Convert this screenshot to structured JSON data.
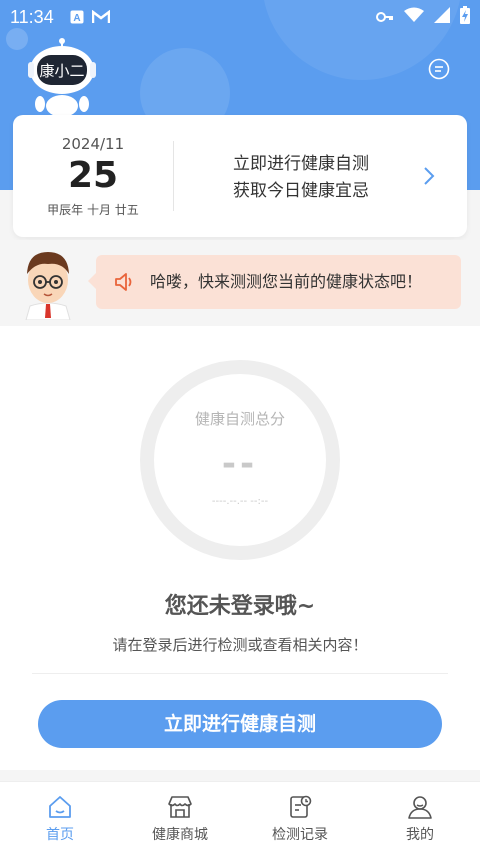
{
  "status_bar": {
    "time": "11:34",
    "icons": [
      "a-notification-icon",
      "gmail-icon",
      "key-icon",
      "wifi-icon",
      "signal-icon",
      "battery-charging-icon"
    ]
  },
  "header": {
    "mascot_text": "康小二",
    "message_icon": "message-bubble-icon"
  },
  "date_card": {
    "year_month": "2024/11",
    "day": "25",
    "lunar": "甲辰年 十月 廿五",
    "cta_line1": "立即进行健康自测",
    "cta_line2": "获取今日健康宜忌"
  },
  "notice": {
    "text": "哈喽，快来测测您当前的健康状态吧！"
  },
  "score": {
    "label": "健康自测总分",
    "value": "--",
    "date": "----.--.-- --:--"
  },
  "login": {
    "title": "您还未登录哦~",
    "subtitle": "请在登录后进行检测或查看相关内容！",
    "button": "立即进行健康自测"
  },
  "tabs": [
    {
      "label": "首页",
      "icon": "home-icon",
      "active": true
    },
    {
      "label": "健康商城",
      "icon": "shop-icon",
      "active": false
    },
    {
      "label": "检测记录",
      "icon": "record-icon",
      "active": false
    },
    {
      "label": "我的",
      "icon": "user-icon",
      "active": false
    }
  ],
  "colors": {
    "primary": "#5b9def",
    "notice_bg": "#fbe1d6",
    "speaker": "#e9643b"
  }
}
